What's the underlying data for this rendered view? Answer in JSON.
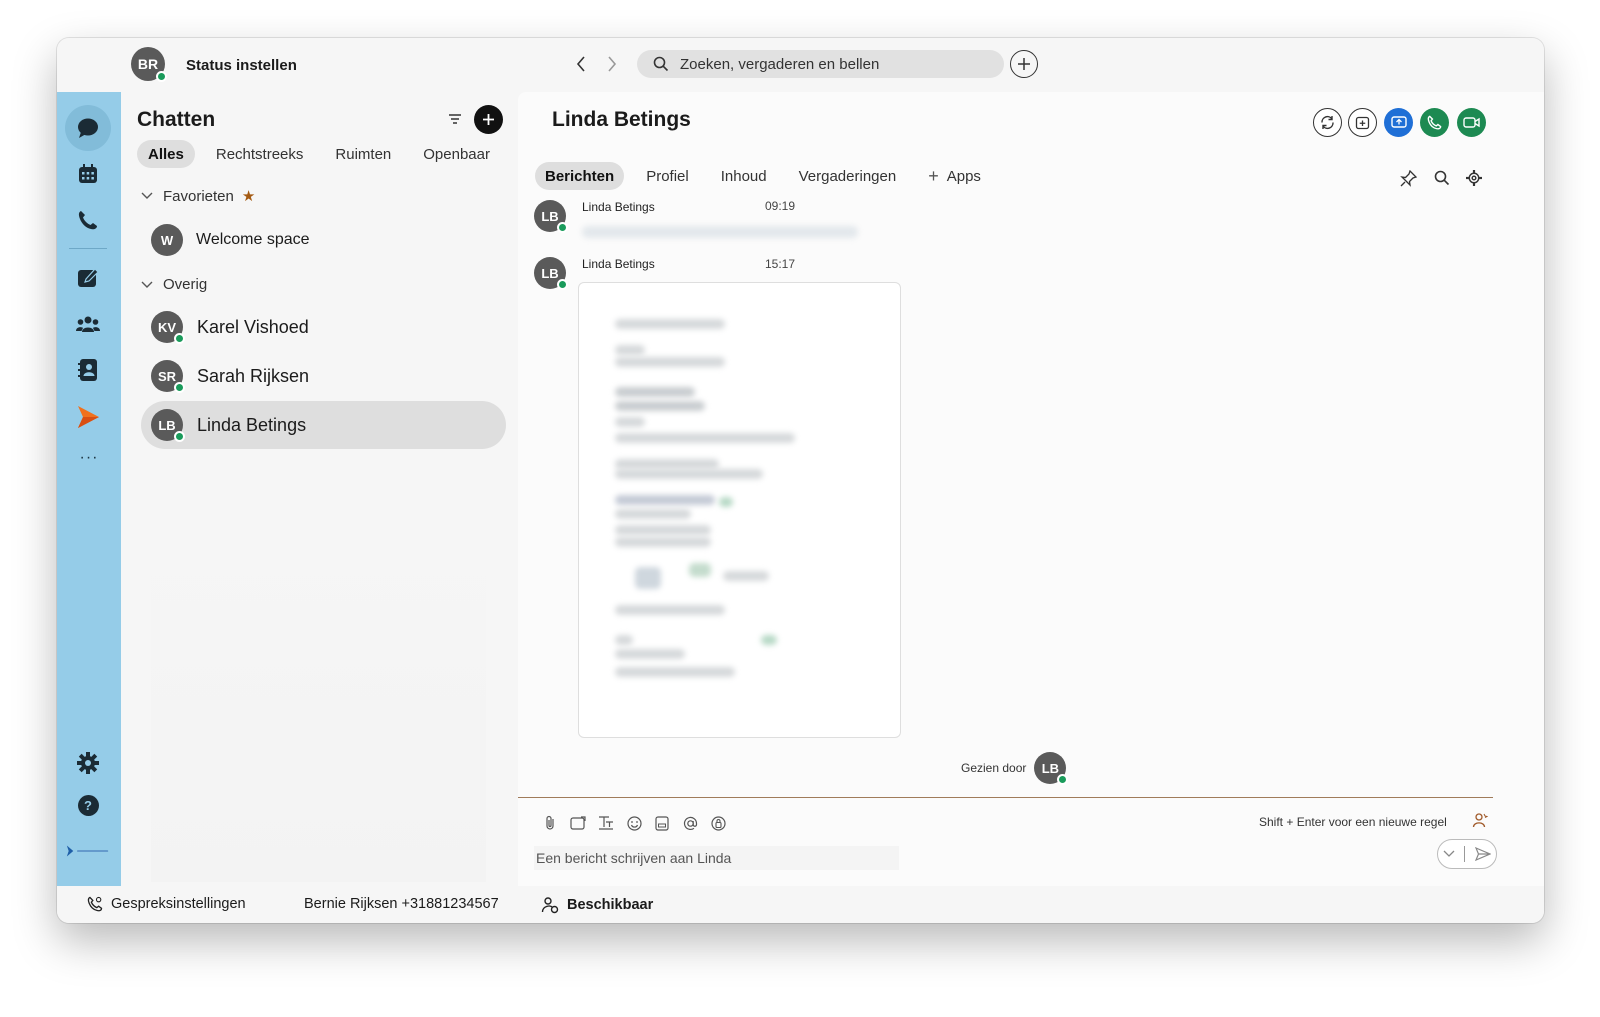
{
  "titlebar": {
    "user_initials": "BR",
    "status_label": "Status instellen",
    "search_placeholder": "Zoeken, vergaderen en bellen"
  },
  "rail": {
    "icons": [
      "chat-icon",
      "calendar-icon",
      "phone-icon",
      "whiteboard-icon",
      "teams-icon",
      "contacts-icon",
      "webex-app-icon",
      "more-icon",
      "settings-icon",
      "help-icon",
      "brand-logo"
    ],
    "more_label": "···",
    "help_label": "?"
  },
  "chatlist": {
    "title": "Chatten",
    "filters": [
      {
        "label": "Alles",
        "active": true
      },
      {
        "label": "Rechtstreeks",
        "active": false
      },
      {
        "label": "Ruimten",
        "active": false
      },
      {
        "label": "Openbaar",
        "active": false
      }
    ],
    "groups": {
      "favorites_label": "Favorieten",
      "other_label": "Overig"
    },
    "favorites": [
      {
        "initials": "W",
        "name": "Welcome space"
      }
    ],
    "other": [
      {
        "initials": "KV",
        "name": "Karel Vishoed",
        "online": true
      },
      {
        "initials": "SR",
        "name": "Sarah Rijksen",
        "online": true
      },
      {
        "initials": "LB",
        "name": "Linda Betings",
        "online": true,
        "selected": true
      }
    ]
  },
  "chat": {
    "title": "Linda Betings",
    "tabs": [
      {
        "label": "Berichten",
        "active": true
      },
      {
        "label": "Profiel",
        "active": false
      },
      {
        "label": "Inhoud",
        "active": false
      },
      {
        "label": "Vergaderingen",
        "active": false
      }
    ],
    "apps_label": "Apps",
    "messages": [
      {
        "initials": "LB",
        "sender": "Linda Betings",
        "time": "09:19",
        "content": "blurred-text"
      },
      {
        "initials": "LB",
        "sender": "Linda Betings",
        "time": "15:17",
        "content": "blurred-attachment"
      }
    ],
    "seen_label": "Gezien door",
    "seen_initials": "LB",
    "composer": {
      "hint": "Shift + Enter voor een nieuwe regel",
      "placeholder": "Een bericht schrijven aan Linda"
    }
  },
  "footer": {
    "call_settings": "Gespreksinstellingen",
    "caller_id": "Bernie Rijksen +31881234567",
    "availability": "Beschikbaar"
  },
  "colors": {
    "rail": "#95cce8",
    "presence": "#1a9b5b",
    "share_button": "#1f6fd6",
    "call_button": "#1d8a52",
    "favorite_star": "#a45a12"
  }
}
